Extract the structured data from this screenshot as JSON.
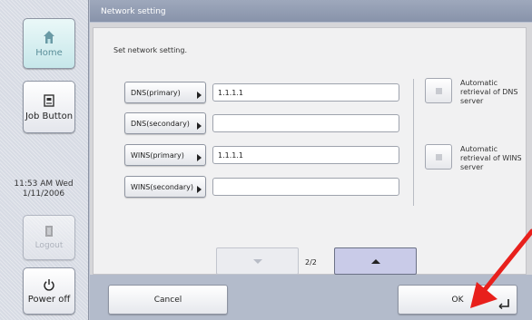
{
  "sidebar": {
    "home_label": "Home",
    "job_label": "Job Button",
    "clock_time": "11:53 AM  Wed",
    "clock_date": "1/11/2006",
    "logout_label": "Logout",
    "power_label": "Power off"
  },
  "header": {
    "title": "Network setting"
  },
  "main": {
    "instruction": "Set network setting.",
    "fields": [
      {
        "label": "DNS(primary)",
        "value": "1.1.1.1"
      },
      {
        "label": "DNS(secondary)",
        "value": ""
      },
      {
        "label": "WINS(primary)",
        "value": "1.1.1.1"
      },
      {
        "label": "WINS(secondary)",
        "value": ""
      }
    ],
    "checks": [
      {
        "label": "Automatic retrieval of DNS server",
        "checked": false
      },
      {
        "label": "Automatic retrieval of WINS server",
        "checked": false
      }
    ],
    "pager": {
      "indicator": "2/2"
    }
  },
  "footer": {
    "cancel_label": "Cancel",
    "ok_label": "OK"
  },
  "colors": {
    "annotation_arrow": "#e8201c",
    "header": "#8893aa",
    "selected_page_button": "#c9cbe8"
  }
}
